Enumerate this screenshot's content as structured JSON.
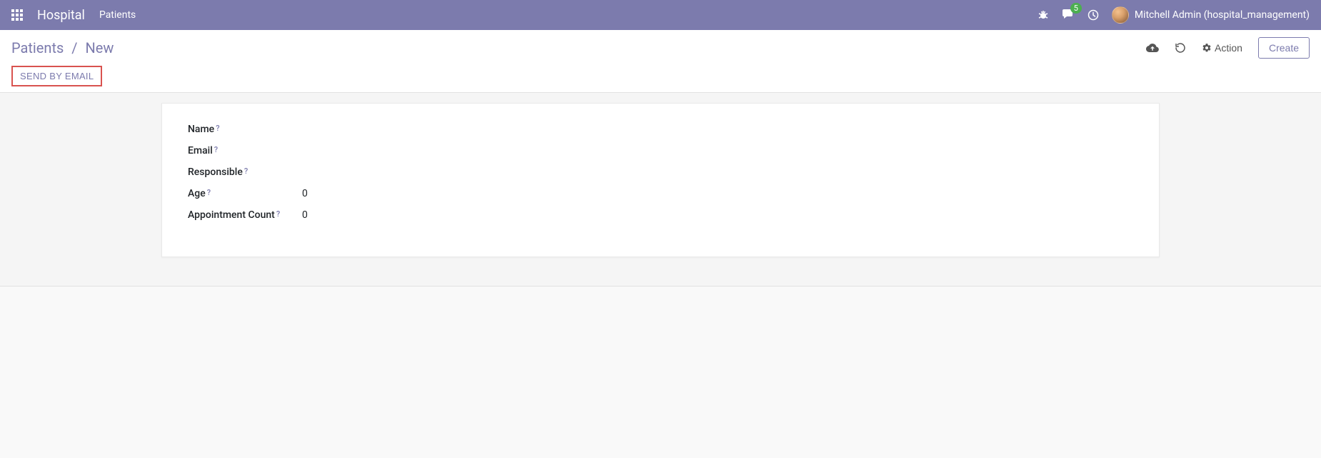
{
  "navbar": {
    "brand": "Hospital",
    "menu": [
      "Patients"
    ],
    "messages_badge": "5",
    "user_label": "Mitchell Admin (hospital_management)"
  },
  "control_panel": {
    "breadcrumb": {
      "root": "Patients",
      "current": "New"
    },
    "action_label": "Action",
    "create_label": "Create",
    "status_button": "SEND BY EMAIL"
  },
  "form": {
    "fields": [
      {
        "label": "Name",
        "value": ""
      },
      {
        "label": "Email",
        "value": ""
      },
      {
        "label": "Responsible",
        "value": ""
      },
      {
        "label": "Age",
        "value": "0"
      },
      {
        "label": "Appointment Count",
        "value": "0"
      }
    ]
  }
}
